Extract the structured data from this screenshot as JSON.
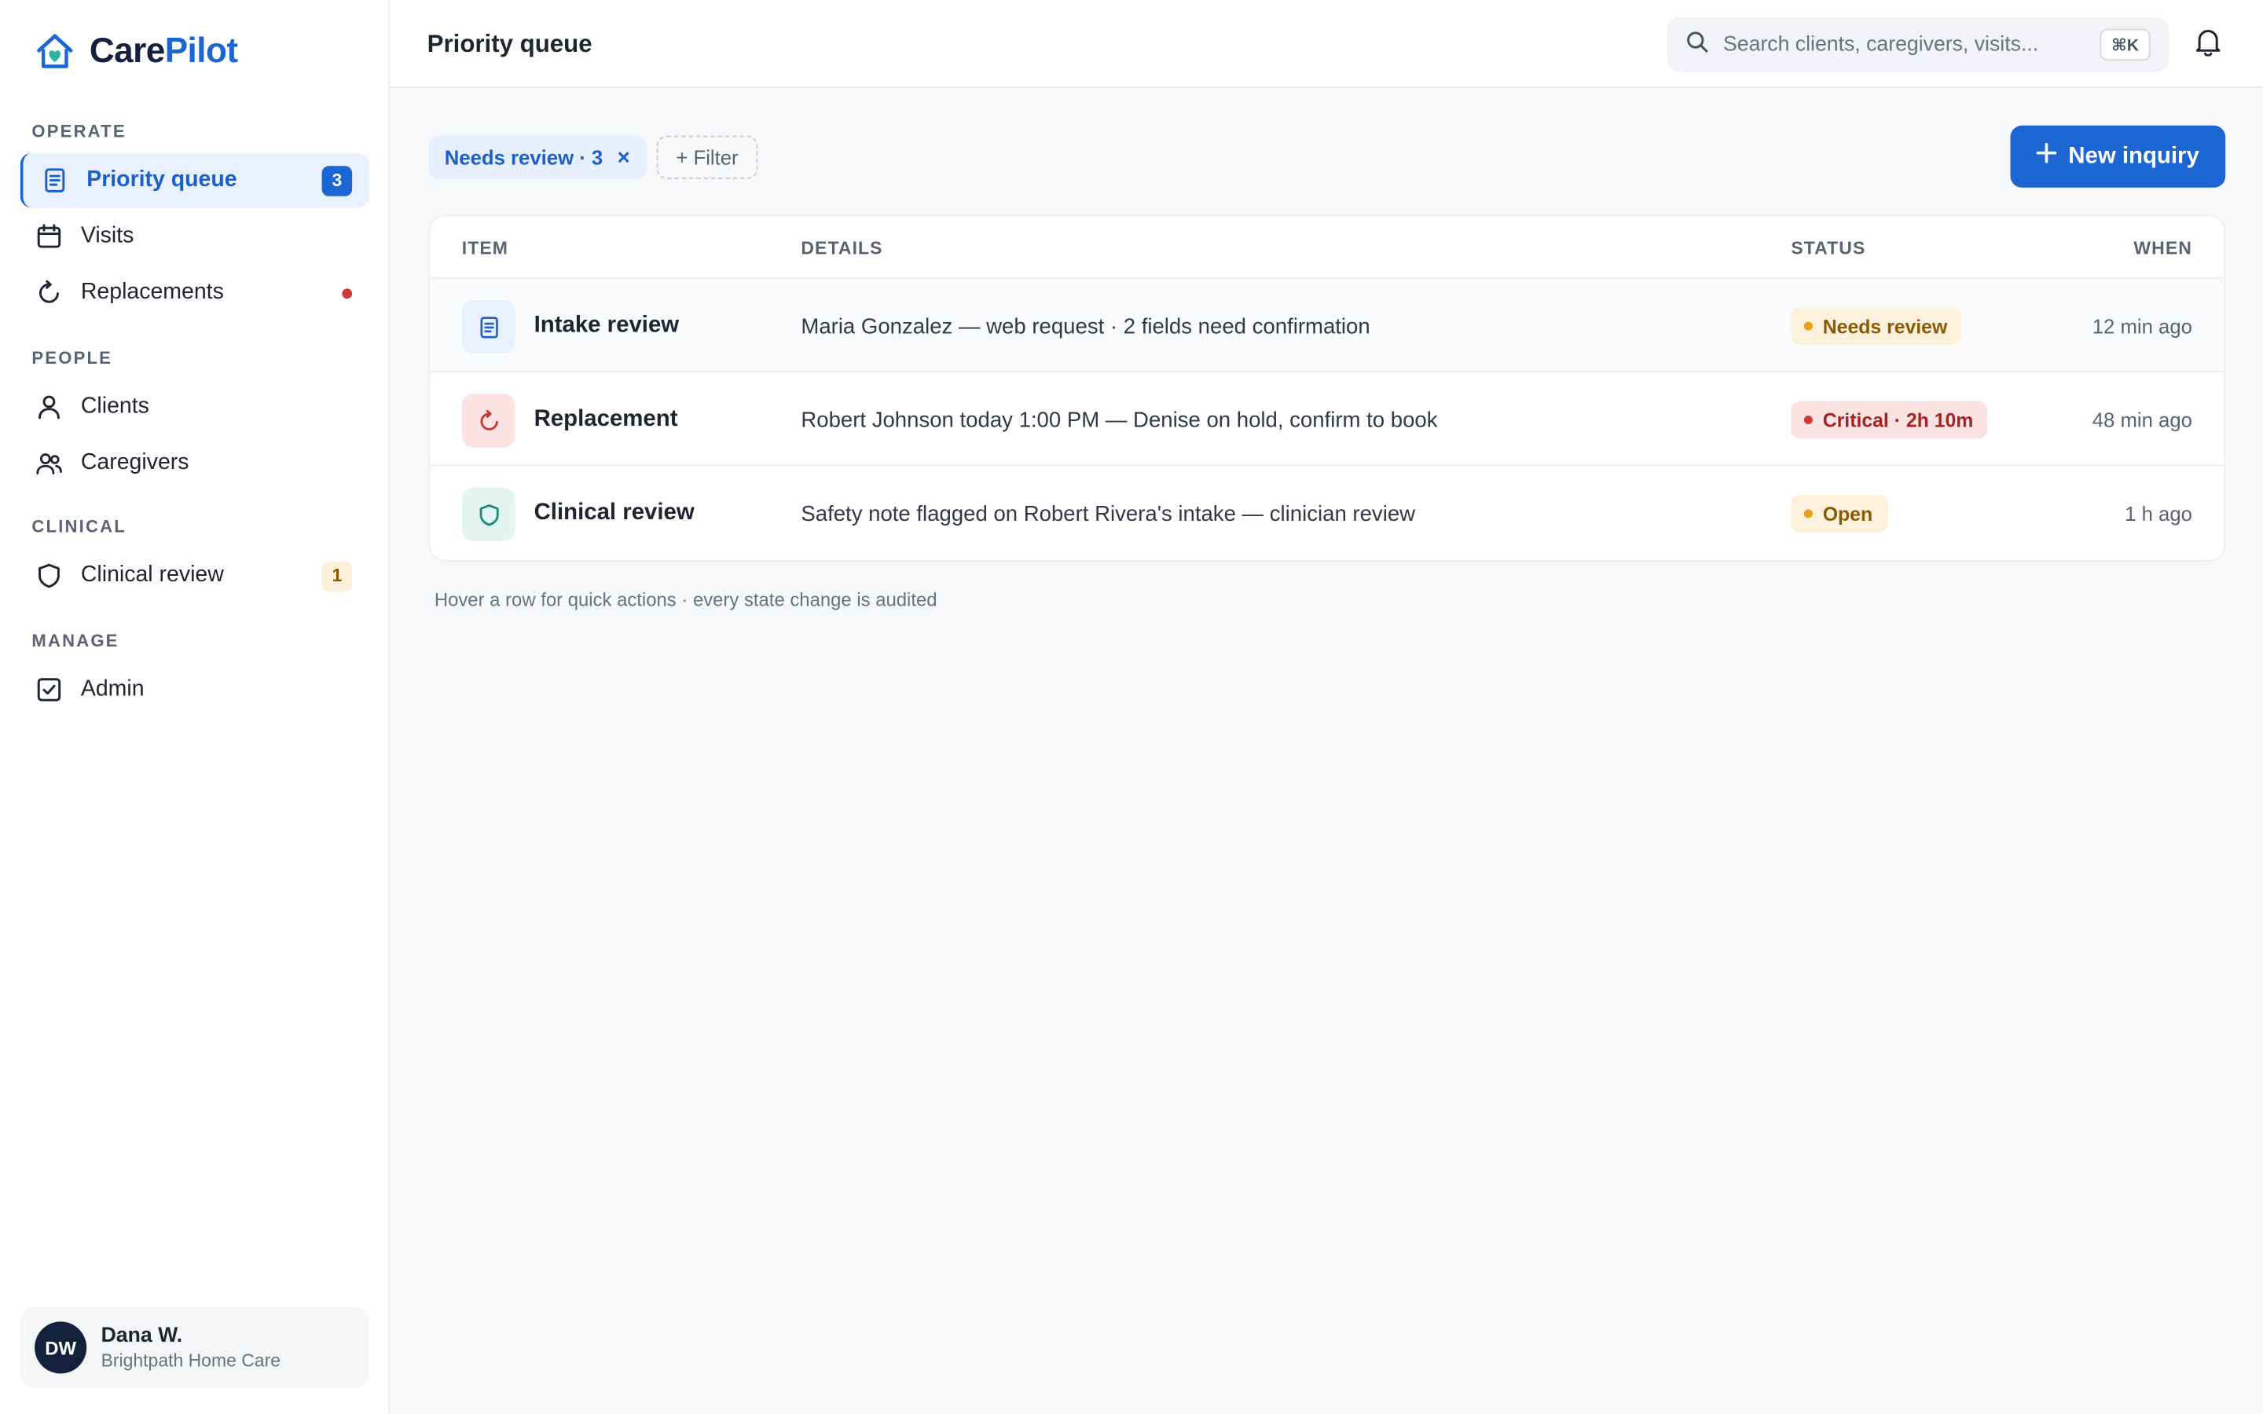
{
  "brand": {
    "name_part1": "Care",
    "name_part2": "Pilot",
    "accent": "#1c66d4"
  },
  "sidebar": {
    "sections": [
      {
        "label": "OPERATE"
      },
      {
        "label": "PEOPLE"
      },
      {
        "label": "CLINICAL"
      },
      {
        "label": "MANAGE"
      }
    ],
    "items": [
      {
        "label": "Priority queue",
        "icon": "document-icon",
        "badge": "3",
        "active": true
      },
      {
        "label": "Visits",
        "icon": "calendar-icon"
      },
      {
        "label": "Replacements",
        "icon": "refresh-icon",
        "indicator": "red-dot"
      },
      {
        "label": "Clients",
        "icon": "user-icon"
      },
      {
        "label": "Caregivers",
        "icon": "users-icon"
      },
      {
        "label": "Clinical review",
        "icon": "shield-icon",
        "badge": "1"
      },
      {
        "label": "Admin",
        "icon": "checkbox-icon"
      }
    ],
    "user": {
      "initials": "DW",
      "name": "Dana W.",
      "org": "Brightpath Home Care"
    }
  },
  "header": {
    "title": "Priority queue",
    "search_placeholder": "Search clients, caregivers, visits...",
    "shortcut": "⌘K"
  },
  "toolbar": {
    "active_filter": "Needs review · 3",
    "remove_filter": "×",
    "add_filter": "+ Filter",
    "new_button": "New inquiry"
  },
  "table": {
    "columns": [
      "ITEM",
      "DETAILS",
      "STATUS",
      "WHEN"
    ],
    "rows": [
      {
        "icon": "document-icon",
        "title": "Intake review",
        "details": "Maria Gonzalez — web request · 2 fields need confirmation",
        "status": "Needs review",
        "status_color": "amber",
        "when": "12 min ago"
      },
      {
        "icon": "refresh-icon",
        "title": "Replacement",
        "details": "Robert Johnson today 1:00 PM — Denise on hold, confirm to book",
        "status": "Critical · 2h 10m",
        "status_color": "red",
        "when": "48 min ago"
      },
      {
        "icon": "shield-icon",
        "title": "Clinical review",
        "details": "Safety note flagged on Robert Rivera's intake — clinician review",
        "status": "Open",
        "status_color": "amber",
        "when": "1 h ago"
      }
    ]
  },
  "footnote": "Hover a row for quick actions · every state change is audited"
}
